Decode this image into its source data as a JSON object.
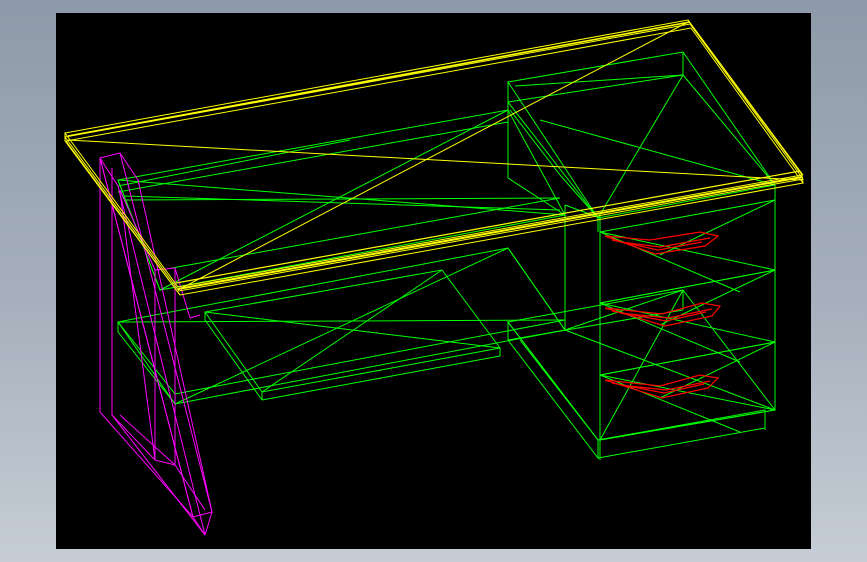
{
  "scene": {
    "background": "#000000",
    "frame_gradient": [
      "#8e9aa9",
      "#c6cdd6"
    ],
    "colors": {
      "tabletop": "#ffff00",
      "leg_frame": "#ff00ff",
      "body_wireframe": "#00ff00",
      "drawer_handle": "#ff0000"
    },
    "parts": [
      "tabletop",
      "side-leg-frame",
      "modesty-panel",
      "keyboard-tray",
      "drawer-pedestal",
      "drawer-handles"
    ]
  }
}
